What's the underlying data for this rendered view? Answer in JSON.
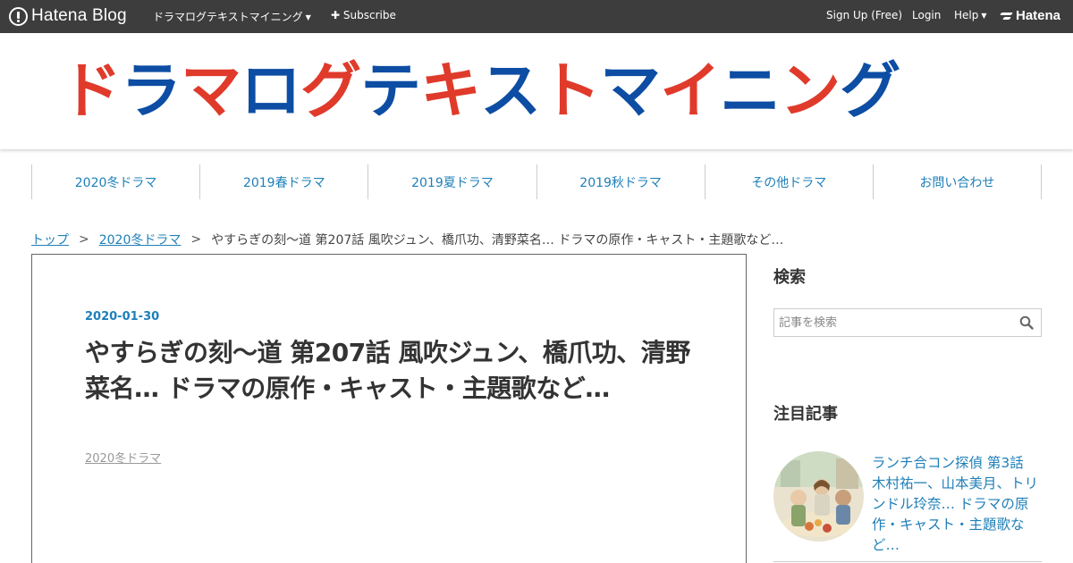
{
  "topbar": {
    "brand": "Hatena Blog",
    "blog_menu": "ドラマログテキストマイニング",
    "subscribe": "Subscribe",
    "signup": "Sign Up (Free)",
    "login": "Login",
    "help": "Help",
    "hatena": "Hatena"
  },
  "header": {
    "logo_chars": [
      "ド",
      "ラ",
      "マ",
      "ロ",
      "グ",
      "テ",
      "キ",
      "ス",
      "ト",
      "マ",
      "イ",
      "ニ",
      "ン",
      "グ"
    ],
    "logo_colors": [
      "#e03a2b",
      "#0d4da3",
      "#e03a2b",
      "#0d4da3",
      "#e03a2b",
      "#0d4da3",
      "#e03a2b",
      "#0d4da3",
      "#e03a2b",
      "#0d4da3",
      "#e03a2b",
      "#0d4da3",
      "#e03a2b",
      "#0d4da3"
    ]
  },
  "nav": {
    "items": [
      "2020冬ドラマ",
      "2019春ドラマ",
      "2019夏ドラマ",
      "2019秋ドラマ",
      "その他ドラマ",
      "お問い合わせ"
    ]
  },
  "breadcrumb": {
    "top": "トップ",
    "category": "2020冬ドラマ",
    "current": "やすらぎの刻～道 第207話 風吹ジュン、橋爪功、清野菜名… ドラマの原作・キャスト・主題歌など…"
  },
  "article": {
    "date": "2020-01-30",
    "title": "やすらぎの刻～道 第207話 風吹ジュン、橋爪功、清野菜名… ドラマの原作・キャスト・主題歌など…",
    "category": "2020冬ドラマ"
  },
  "sidebar": {
    "search_heading": "検索",
    "search_placeholder": "記事を検索",
    "featured_heading": "注目記事",
    "featured": [
      {
        "title": "ランチ合コン探偵 第3話 木村祐一、山本美月、トリンドル玲奈… ドラマの原作・キャスト・主題歌など…"
      }
    ]
  },
  "colors": {
    "topbar_bg": "#3d3d3d",
    "link": "#1e7fb8",
    "logo_red": "#e03a2b",
    "logo_blue": "#0d4da3"
  }
}
